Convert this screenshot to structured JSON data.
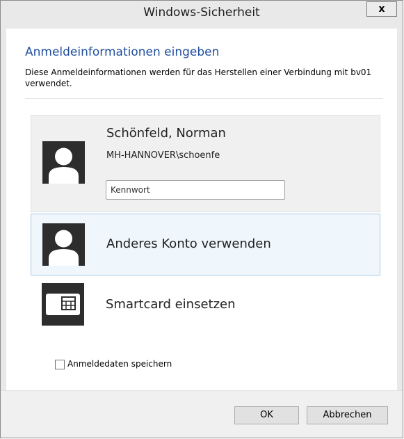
{
  "window": {
    "title": "Windows-Sicherheit",
    "close_label": "x"
  },
  "header": {
    "heading": "Anmeldeinformationen eingeben",
    "description": "Diese Anmeldeinformationen werden für das Herstellen einer Verbindung mit bv01 verwendet."
  },
  "accounts": {
    "current": {
      "name": "Schönfeld, Norman",
      "domain_user": "MH-HANNOVER\\schoenfe",
      "password_placeholder": "Kennwort",
      "icon": "user-avatar-icon"
    },
    "other": {
      "label": "Anderes Konto verwenden",
      "icon": "user-avatar-icon"
    },
    "smartcard": {
      "label": "Smartcard einsetzen",
      "icon": "smartcard-icon"
    }
  },
  "remember": {
    "label": "Anmeldedaten speichern",
    "checked": false
  },
  "buttons": {
    "ok": "OK",
    "cancel": "Abbrechen"
  },
  "colors": {
    "heading": "#1f4f9c",
    "selected_tile_bg": "#eff6fc",
    "selected_tile_border": "#a9cbe8",
    "tile_bg": "#f0f0f0",
    "avatar_bg": "#2d2d2d"
  }
}
